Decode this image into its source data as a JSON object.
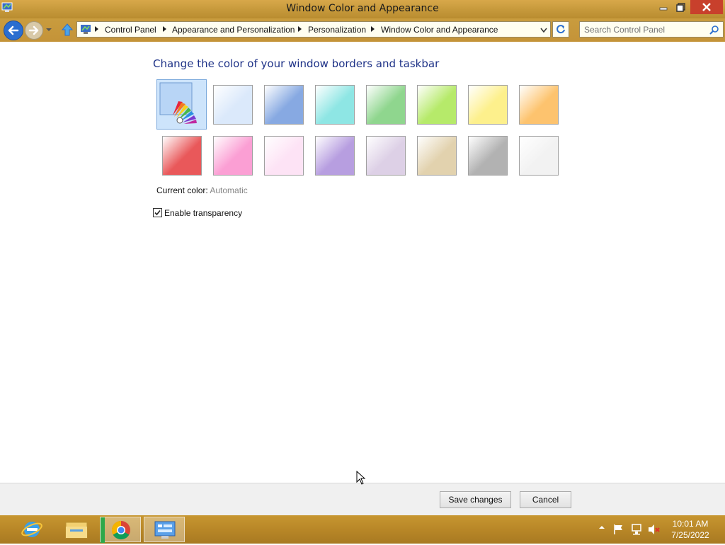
{
  "window": {
    "title": "Window Color and Appearance"
  },
  "breadcrumb": [
    "Control Panel",
    "Appearance and Personalization",
    "Personalization",
    "Window Color and Appearance"
  ],
  "search": {
    "placeholder": "Search Control Panel"
  },
  "main": {
    "heading": "Change the color of your window borders and taskbar",
    "swatches_row1": [
      "#dbe9fb",
      "#87a9e2",
      "#8ee6e4",
      "#8fd68e",
      "#b6ea6a",
      "#fdf08c",
      "#fdc36e"
    ],
    "swatches_row2": [
      "#e9585a",
      "#fb9fd4",
      "#fde3f5",
      "#b79ee0",
      "#ddd0e6",
      "#e2d2ae",
      "#b2b2b2",
      "#f2f2f2"
    ],
    "current_color_label": "Current color:",
    "current_color_value": "Automatic",
    "transparency_label": "Enable transparency",
    "transparency_checked": true
  },
  "footer": {
    "save_label": "Save changes",
    "cancel_label": "Cancel"
  },
  "taskbar": {
    "apps": [
      "internet-explorer",
      "file-explorer",
      "chrome",
      "control-panel"
    ],
    "time": "10:01 AM",
    "date": "7/25/2022"
  }
}
